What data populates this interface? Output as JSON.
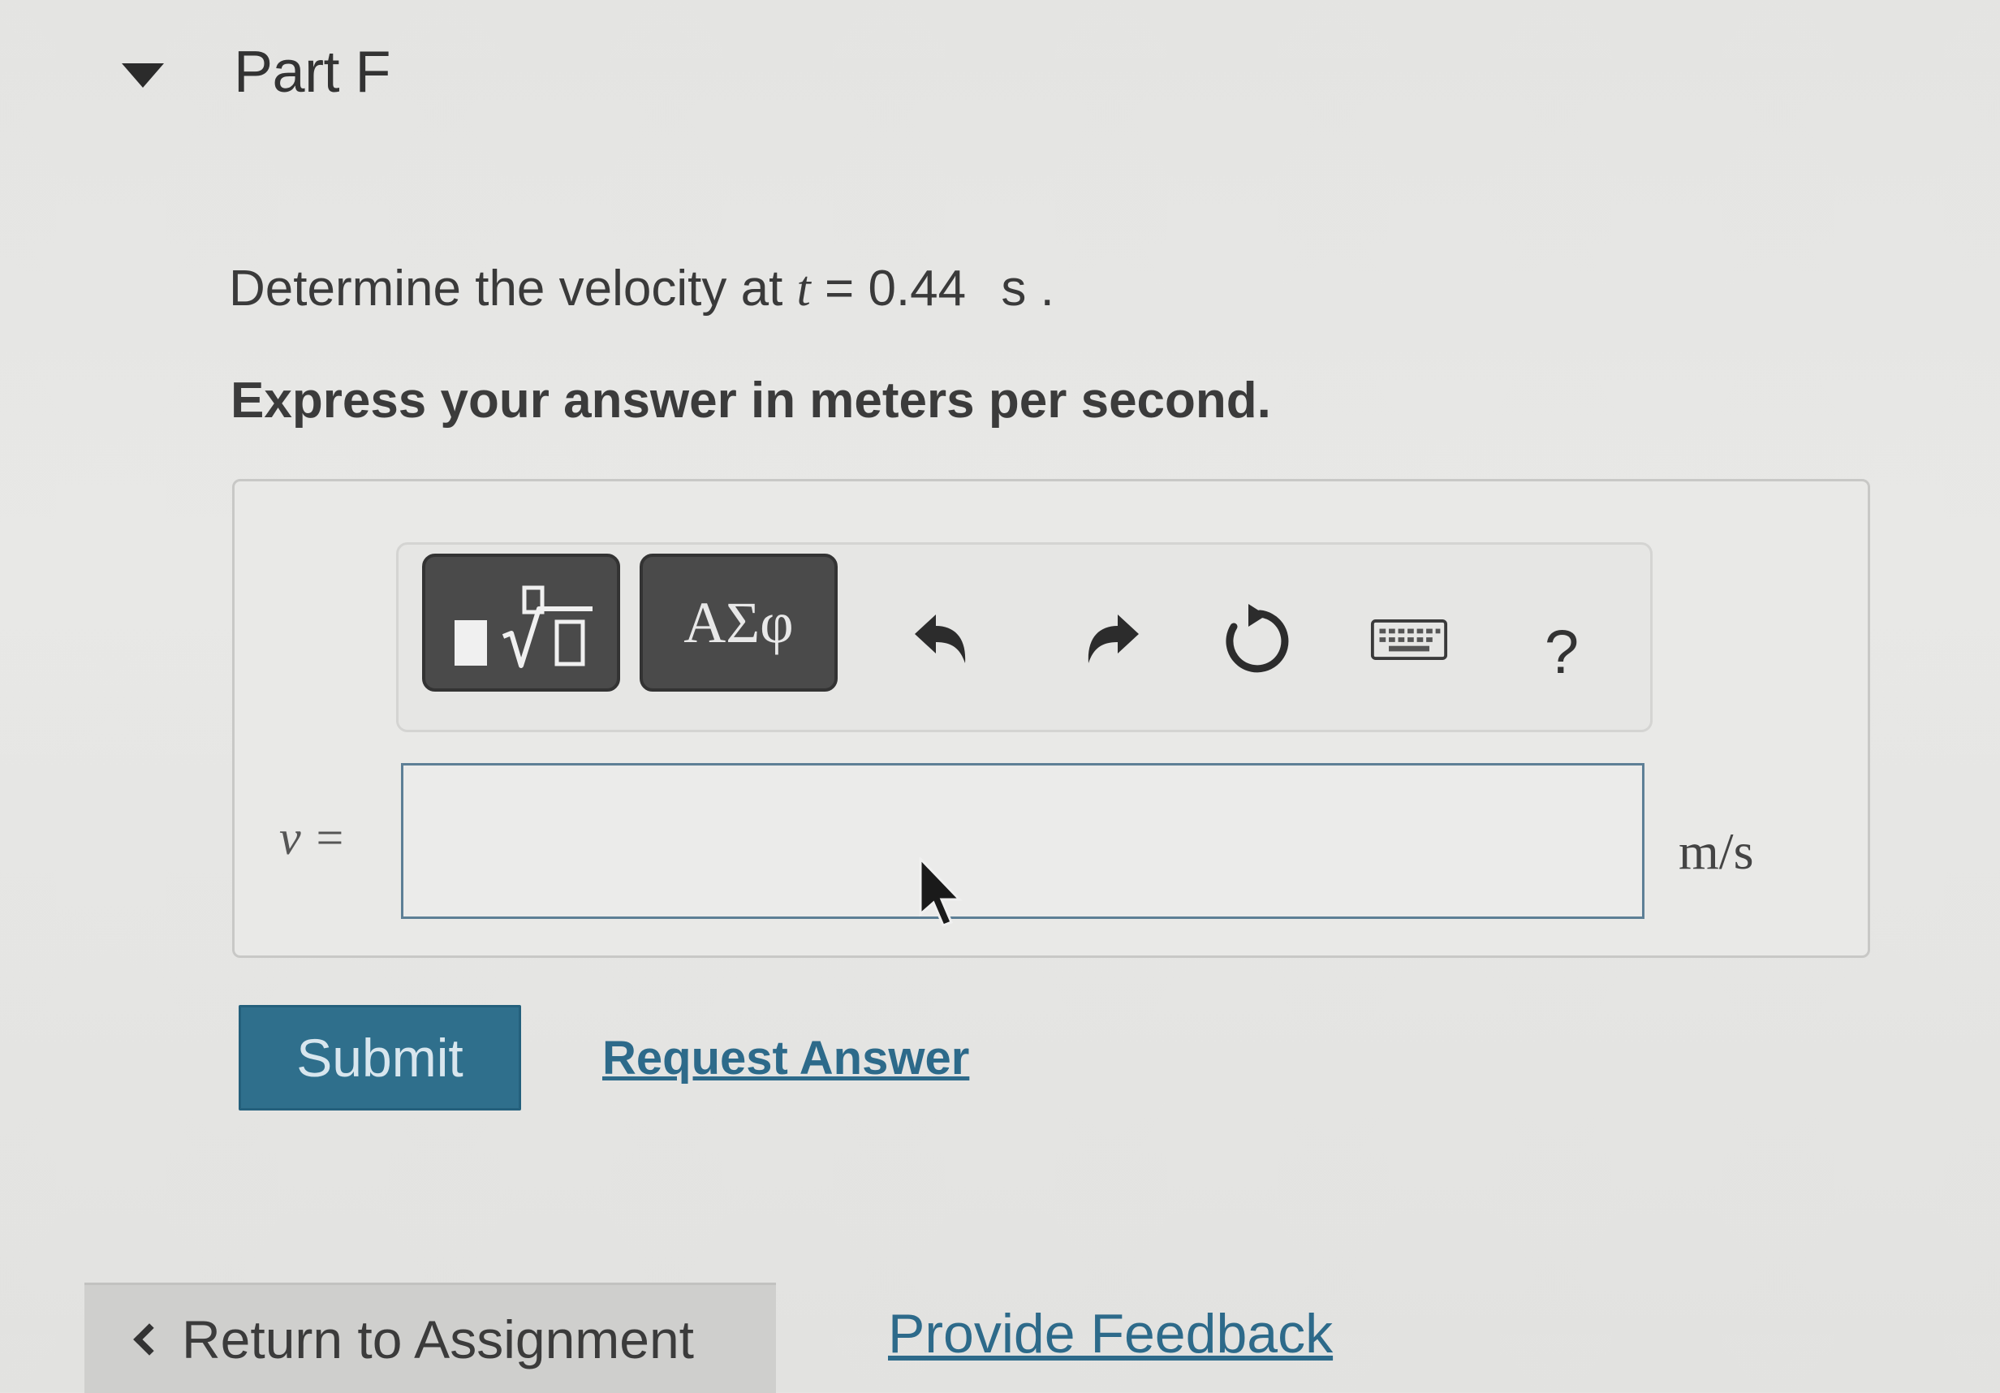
{
  "header": {
    "title": "Part F"
  },
  "question": {
    "prefix": "Determine the velocity at",
    "variable": "t",
    "equals": " = 0.44",
    "unit": "s",
    "suffix": "."
  },
  "instruction": "Express your answer in meters per second.",
  "toolbar": {
    "templates_icon": "templates-sqrt-icon",
    "symbols_label": "ΑΣφ",
    "undo_icon": "undo-icon",
    "redo_icon": "redo-icon",
    "reset_icon": "reset-icon",
    "keyboard_icon": "keyboard-icon",
    "help_label": "?"
  },
  "answer": {
    "variable_label": "v =",
    "value": "",
    "unit": "m/s"
  },
  "actions": {
    "submit_label": "Submit",
    "request_answer_label": "Request Answer"
  },
  "footer": {
    "return_label": "Return to Assignment",
    "feedback_label": "Provide Feedback"
  },
  "colors": {
    "submit_bg": "#2f6f8c",
    "link": "#2d6a8a",
    "tool_dark": "#4a4a4a"
  }
}
